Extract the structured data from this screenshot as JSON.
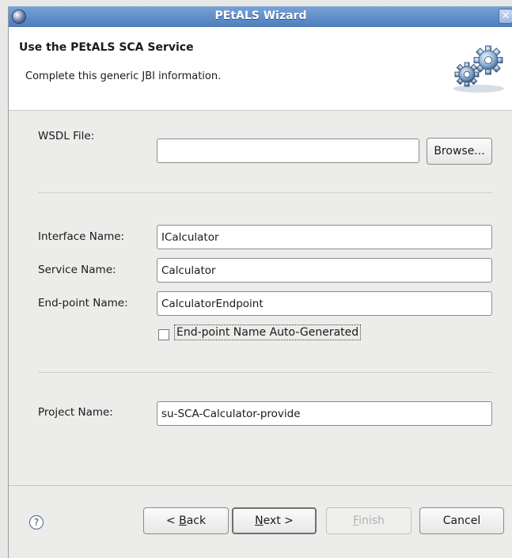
{
  "window": {
    "title": "PEtALS Wizard"
  },
  "header": {
    "title": "Use the PEtALS SCA Service",
    "description": "Complete this generic JBI information."
  },
  "form": {
    "wsdl_label": "WSDL File:",
    "wsdl_value": "",
    "browse_label": "Browse...",
    "interface_label": "Interface Name:",
    "interface_value": "ICalculator",
    "service_label": "Service Name:",
    "service_value": "Calculator",
    "endpoint_label": "End-point Name:",
    "endpoint_value": "CalculatorEndpoint",
    "autogen_label": "End-point Name Auto-Generated",
    "autogen_checked": false,
    "project_label": "Project Name:",
    "project_value": "su-SCA-Calculator-provide"
  },
  "footer": {
    "help_glyph": "?",
    "back_prefix": "< ",
    "back_key": "B",
    "back_rest": "ack",
    "next_key": "N",
    "next_rest": "ext >",
    "finish_key": "F",
    "finish_rest": "inish",
    "cancel_label": "Cancel"
  },
  "icons": {
    "app": "eclipse-icon",
    "close": "close-icon",
    "banner": "gears-icon",
    "help": "help-icon"
  }
}
